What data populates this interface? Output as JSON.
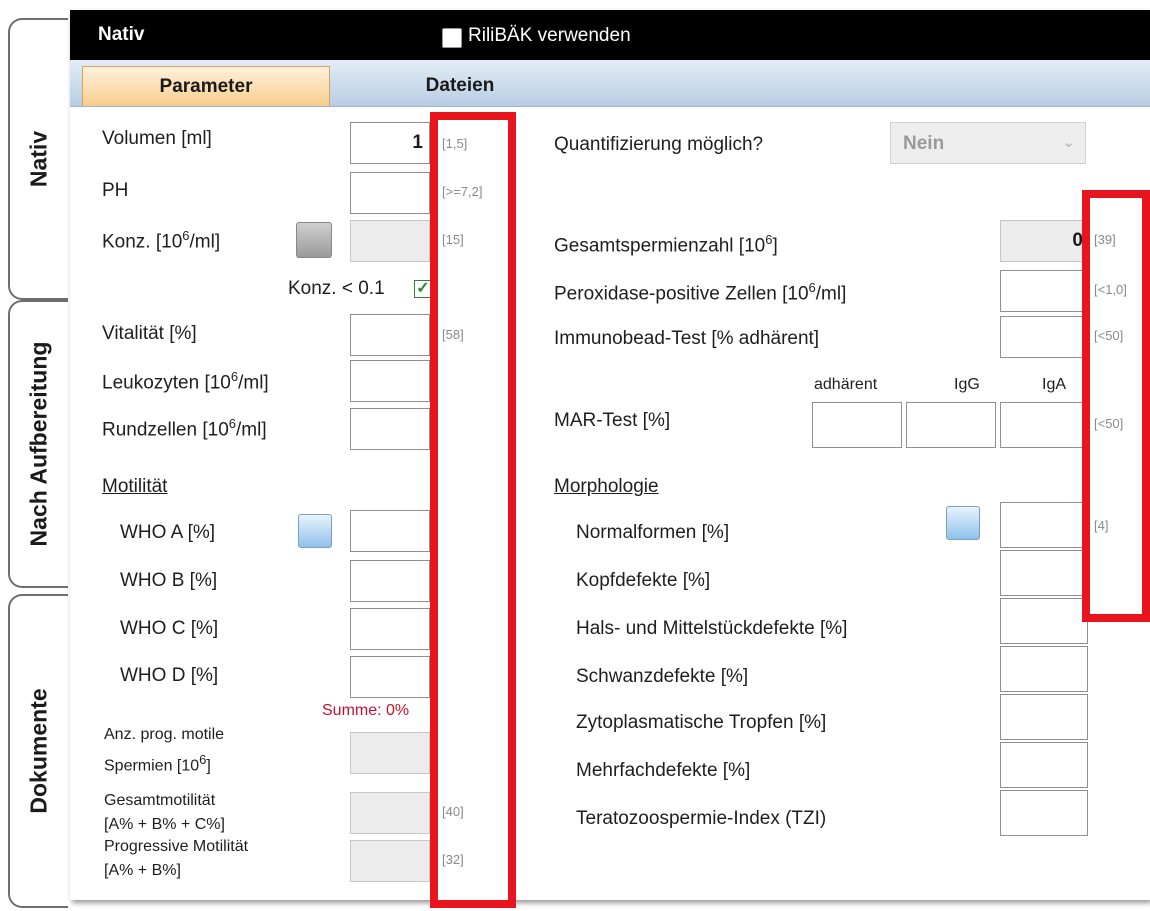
{
  "side_tabs": [
    "Nativ",
    "Nach Aufbereitung",
    "Dokumente"
  ],
  "titlebar": {
    "title": "Nativ",
    "rilibak_label": "RiliBÄK verwenden"
  },
  "tabs": [
    {
      "label": "Parameter",
      "active": true
    },
    {
      "label": "Dateien",
      "active": false
    }
  ],
  "left": {
    "volumen": {
      "label": "Volumen [ml]",
      "value": "1",
      "ref": "[1,5]"
    },
    "ph": {
      "label": "PH",
      "value": "",
      "ref": "[>=7,2]"
    },
    "konz": {
      "label_pre": "Konz. [10",
      "sup": "6",
      "label_post": "/ml]",
      "value": "",
      "ref": "[15]"
    },
    "konz_lt": {
      "label": "Konz. < 0.1"
    },
    "vitalitaet": {
      "label": "Vitalität [%]",
      "value": "",
      "ref": "[58]"
    },
    "leukozyten": {
      "label_pre": "Leukozyten [10",
      "sup": "6",
      "label_post": "/ml]",
      "value": ""
    },
    "rundzellen": {
      "label_pre": "Rundzellen [10",
      "sup": "6",
      "label_post": "/ml]",
      "value": ""
    },
    "motilitaet_title": "Motilität",
    "who": [
      {
        "label": "WHO A [%]",
        "value": ""
      },
      {
        "label": "WHO B [%]",
        "value": ""
      },
      {
        "label": "WHO C [%]",
        "value": ""
      },
      {
        "label": "WHO D [%]",
        "value": ""
      }
    ],
    "summe": "Summe: 0%",
    "anz_prog": {
      "line1": "Anz. prog. motile",
      "line2_pre": "Spermien [10",
      "sup": "6",
      "line2_post": "]",
      "value": ""
    },
    "gesamtmot": {
      "line1": "Gesamtmotilität",
      "line2": "[A% + B% + C%]",
      "value": "",
      "ref": "[40]"
    },
    "progmot": {
      "line1": "Progressive Motilität",
      "line2": "[A% + B%]",
      "value": "",
      "ref": "[32]"
    }
  },
  "right": {
    "quant": {
      "label": "Quantifizierung möglich?",
      "selected": "Nein"
    },
    "gesamtspermien": {
      "label_pre": "Gesamtspermienzahl [10",
      "sup": "6",
      "label_post": "]",
      "value": "0",
      "ref": "[39]"
    },
    "peroxidase": {
      "label_pre": "Peroxidase-positive Zellen [10",
      "sup": "6",
      "label_post": "/ml]",
      "value": "",
      "ref": "[<1,0]"
    },
    "immunobead": {
      "label": "Immunobead-Test [% adhärent]",
      "value": "",
      "ref": "[<50]"
    },
    "mar": {
      "label": "MAR-Test [%]",
      "col_headers": [
        "adhärent",
        "IgG",
        "IgA"
      ],
      "values": [
        "",
        "",
        ""
      ],
      "ref": "[<50]"
    },
    "morphologie_title": "Morphologie",
    "morph": [
      {
        "label": "Normalformen [%]",
        "value": "",
        "ref": "[4]"
      },
      {
        "label": "Kopfdefekte [%]",
        "value": ""
      },
      {
        "label": "Hals- und Mittelstückdefekte [%]",
        "value": ""
      },
      {
        "label": "Schwanzdefekte [%]",
        "value": ""
      },
      {
        "label": "Zytoplasmatische Tropfen [%]",
        "value": ""
      },
      {
        "label": "Mehrfachdefekte [%]",
        "value": ""
      },
      {
        "label": "Teratozoospermie-Index (TZI)",
        "value": ""
      }
    ]
  },
  "icons": {
    "calculator": "calculator-icon",
    "checkbox": "checkbox-icon",
    "dropdown": "chevron-down-icon",
    "grid": "grid-icon"
  },
  "colors": {
    "highlight": "#e8141e",
    "summe": "#c8102e",
    "active_tab": "#f9d7a1"
  }
}
